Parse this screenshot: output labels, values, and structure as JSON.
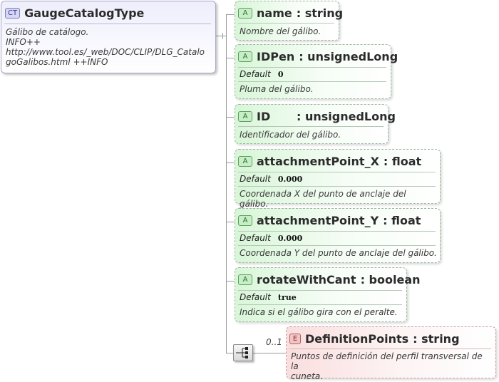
{
  "complex_type": {
    "badge": "CT",
    "name": "GaugeCatalogType",
    "description_lines": [
      "Gálibo de catálogo.",
      "INFO++",
      "http://www.tool.es/_web/DOC/CLIP/DLG_Catalo",
      "goGalibos.html ++INFO"
    ]
  },
  "attributes": [
    {
      "badge": "A",
      "name": "name",
      "type": ": string",
      "default_label": "",
      "default_value": "",
      "description": "Nombre del gálibo."
    },
    {
      "badge": "A",
      "name": "IDPen",
      "type": ": unsignedLong",
      "default_label": "Default",
      "default_value": "0",
      "description": "Pluma del gálibo."
    },
    {
      "badge": "A",
      "name": "ID",
      "type": ": unsignedLong",
      "default_label": "",
      "default_value": "",
      "description": "Identificador del gálibo."
    },
    {
      "badge": "A",
      "name": "attachmentPoint_X",
      "type": ": float",
      "default_label": "Default",
      "default_value": "0.000",
      "description": "Coordenada X del punto de anclaje del gálibo."
    },
    {
      "badge": "A",
      "name": "attachmentPoint_Y",
      "type": ": float",
      "default_label": "Default",
      "default_value": "0.000",
      "description": "Coordenada Y del punto de anclaje del gálibo."
    },
    {
      "badge": "A",
      "name": "rotateWithCant",
      "type": ": boolean",
      "default_label": "Default",
      "default_value": "true",
      "description": "Indica si el gálibo gira con el peralte."
    }
  ],
  "sequence": {
    "icon": "sequence-compositor-icon",
    "cardinality": "0..1"
  },
  "element": {
    "badge": "E",
    "name": "DefinitionPoints",
    "type": ": string",
    "description_lines": [
      "Puntos de definición del perfil transversal de la",
      "cuneta."
    ]
  },
  "colors": {
    "attribute_fill": "#d8f6d8",
    "element_fill": "#fadede",
    "complex_type_fill": "#eeeefc"
  }
}
